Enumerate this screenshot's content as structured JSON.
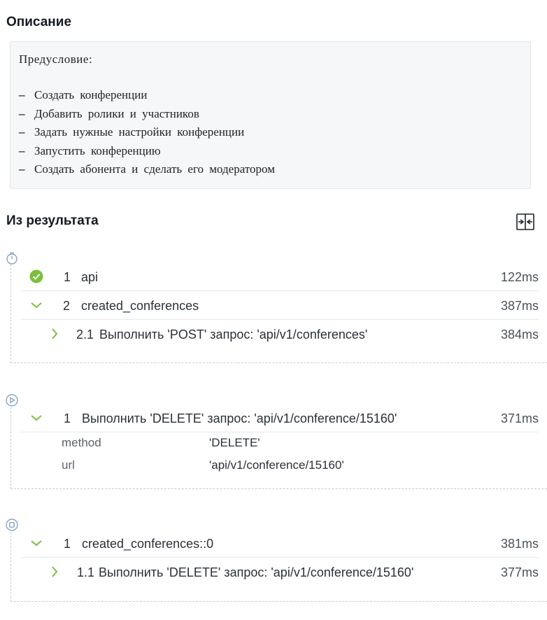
{
  "description": {
    "title": "Описание",
    "precondition": "Предусловие:",
    "items": [
      "Создать конференции",
      "Добавить ролики и участников",
      "Задать нужные настройки конференции",
      "Запустить конференцию",
      "Создать абонента и сделать его модератором"
    ]
  },
  "results": {
    "title": "Из результата",
    "compare_icon": "split-compare-icon",
    "colors": {
      "accent": "#7cbf3c",
      "icon_blue": "#8aa4c0",
      "text": "#2b3138"
    },
    "setup": {
      "icon": "timer-icon",
      "steps": [
        {
          "num": "1",
          "name": "api",
          "time": "122ms",
          "status": "passed-check-icon"
        },
        {
          "num": "2",
          "name": "created_conferences",
          "time": "387ms",
          "status": "chevron-down-icon"
        },
        {
          "num": "2.1",
          "name": "Выполнить 'POST' запрос: 'api/v1/conferences'",
          "time": "384ms",
          "status": "chevron-right-icon"
        }
      ]
    },
    "body": {
      "icon": "play-icon",
      "step": {
        "num": "1",
        "name": "Выполнить 'DELETE' запрос: 'api/v1/conference/15160'",
        "time": "371ms"
      },
      "params": [
        {
          "key": "method",
          "value": "'DELETE'"
        },
        {
          "key": "url",
          "value": "'api/v1/conference/15160'"
        }
      ]
    },
    "teardown": {
      "icon": "stop-icon",
      "steps": [
        {
          "num": "1",
          "name": "created_conferences::0",
          "time": "381ms"
        },
        {
          "num": "1.1",
          "name": "Выполнить 'DELETE' запрос: 'api/v1/conference/15160'",
          "time": "377ms"
        }
      ]
    }
  }
}
